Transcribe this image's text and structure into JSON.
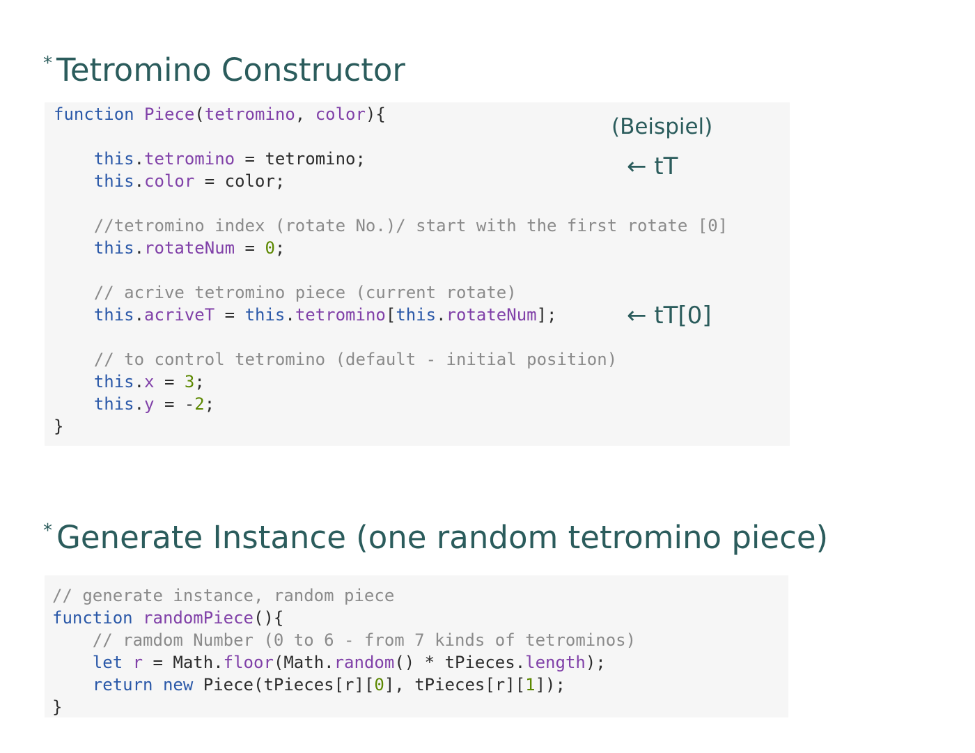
{
  "sections": [
    {
      "bullet": "*",
      "title": "Tetromino Constructor"
    },
    {
      "bullet": "*",
      "title": "Generate Instance (one random tetromino piece)"
    }
  ],
  "annotations": {
    "example": "(Beispiel)",
    "tT": "← tT",
    "tT0": "← tT[0]"
  },
  "code1": {
    "l1_kw": "function",
    "l1_name": "Piece",
    "l1_p1": "(",
    "l1_param1": "tetromino",
    "l1_p2": ", ",
    "l1_param2": "color",
    "l1_p3": "){",
    "l3_this": "this",
    "l3_dot": ".",
    "l3_prop": "tetromino",
    "l3_rest": " = tetromino;",
    "l4_this": "this",
    "l4_dot": ".",
    "l4_prop": "color",
    "l4_rest": " = color;",
    "l6_comment": "//tetromino index (rotate No.)/ start with the first rotate [0]",
    "l7_this": "this",
    "l7_dot": ".",
    "l7_prop": "rotateNum",
    "l7_eq": " = ",
    "l7_num": "0",
    "l7_end": ";",
    "l9_comment": "// acrive tetromino piece (current rotate)",
    "l10_this": "this",
    "l10_dot": ".",
    "l10_prop": "acriveT",
    "l10_eq": " = ",
    "l10_this2": "this",
    "l10_dot2": ".",
    "l10_prop2": "tetromino",
    "l10_br": "[",
    "l10_this3": "this",
    "l10_dot3": ".",
    "l10_prop3": "rotateNum",
    "l10_end": "];",
    "l12_comment": "// to control tetromino (default - initial position)",
    "l13_this": "this",
    "l13_dot": ".",
    "l13_prop": "x",
    "l13_eq": " = ",
    "l13_num": "3",
    "l13_end": ";",
    "l14_this": "this",
    "l14_dot": ".",
    "l14_prop": "y",
    "l14_eq": " = -",
    "l14_num": "2",
    "l14_end": ";",
    "l15_close": "}"
  },
  "code2": {
    "l1_comment": "// generate instance, random piece",
    "l2_kw": "function",
    "l2_name": "randomPiece",
    "l2_rest": "(){",
    "l3_comment": "// ramdom Number (0 to 6 - from 7 kinds of tetrominos)",
    "l4_kw": "let",
    "l4_var": "r",
    "l4_a": " = Math.",
    "l4_floor": "floor",
    "l4_b": "(Math.",
    "l4_random": "random",
    "l4_c": "() * tPieces.",
    "l4_length": "length",
    "l4_d": ");",
    "l5_kw1": "return",
    "l5_kw2": "new",
    "l5_a": " Piece(tPieces[r][",
    "l5_n0": "0",
    "l5_b": "], tPieces[r][",
    "l5_n1": "1",
    "l5_c": "]);",
    "l6_close": "}"
  }
}
